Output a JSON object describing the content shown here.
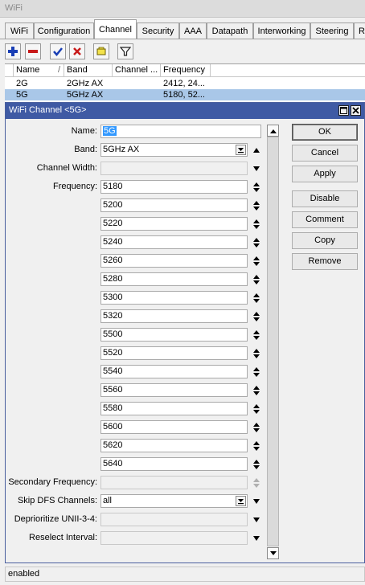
{
  "window": {
    "title": "WiFi"
  },
  "tabs": [
    "WiFi",
    "Configuration",
    "Channel",
    "Security",
    "AAA",
    "Datapath",
    "Interworking",
    "Steering",
    "R"
  ],
  "active_tab": "Channel",
  "toolbar": {
    "icons": [
      "add-icon",
      "remove-icon",
      "enable-icon",
      "disable-icon",
      "comment-icon",
      "filter-icon"
    ]
  },
  "grid": {
    "columns": [
      "Name",
      "Band",
      "Channel ...",
      "Frequency"
    ],
    "rows": [
      {
        "name": "2G",
        "band": "2GHz AX",
        "channel": "",
        "frequency": "2412, 24..."
      },
      {
        "name": "5G",
        "band": "5GHz AX",
        "channel": "",
        "frequency": "5180, 52..."
      }
    ]
  },
  "dialog": {
    "title": "WiFi Channel <5G>",
    "labels": {
      "name": "Name:",
      "band": "Band:",
      "channel_width": "Channel Width:",
      "frequency": "Frequency:",
      "secondary_frequency": "Secondary Frequency:",
      "skip_dfs": "Skip DFS Channels:",
      "deprioritize": "Deprioritize UNII-3-4:",
      "reselect": "Reselect Interval:"
    },
    "values": {
      "name": "5G",
      "band": "5GHz AX",
      "channel_width": "",
      "secondary_frequency": "",
      "skip_dfs": "all",
      "deprioritize": "",
      "reselect": ""
    },
    "frequencies": [
      "5180",
      "5200",
      "5220",
      "5240",
      "5260",
      "5280",
      "5300",
      "5320",
      "5500",
      "5520",
      "5540",
      "5560",
      "5580",
      "5600",
      "5620",
      "5640"
    ],
    "buttons": {
      "ok": "OK",
      "cancel": "Cancel",
      "apply": "Apply",
      "disable": "Disable",
      "comment": "Comment",
      "copy": "Copy",
      "remove": "Remove"
    }
  },
  "status": "enabled"
}
